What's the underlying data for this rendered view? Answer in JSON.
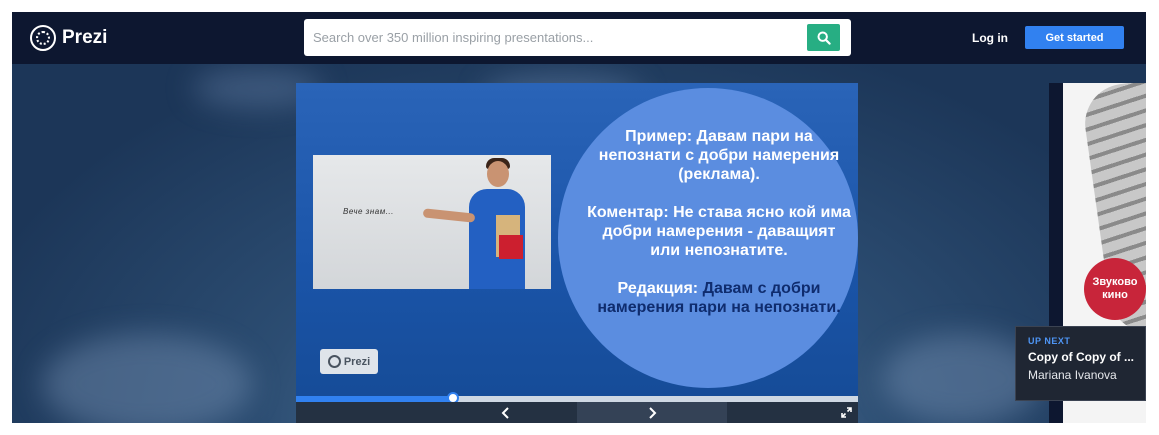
{
  "header": {
    "logo_text": "Prezi",
    "search_placeholder": "Search over 350 million inspiring presentations...",
    "login_label": "Log in",
    "get_started_label": "Get started",
    "accent_color": "#3181f0",
    "search_button_color": "#27ae83"
  },
  "slide": {
    "photo_caption": "Вече знам...",
    "circle_lines": [
      "Пример: Давам пари на непознати с добри намерения (реклама).",
      "Коментар: Не става ясно кой има добри намерения - даващият или непознатите."
    ],
    "editing_label": "Редакция:",
    "editing_text": "Давам с добри намерения пари на непознати.",
    "badge_text": "Prezi",
    "progress_fraction": 0.28
  },
  "controls": {
    "prev_icon": "chevron-left-icon",
    "next_icon": "chevron-right-icon",
    "fullscreen_icon": "expand-icon"
  },
  "side": {
    "thumbnail_label": "Звуково кино",
    "up_next_label": "UP NEXT",
    "up_next_title": "Copy of Copy of ...",
    "up_next_author": "Mariana Ivanova"
  }
}
